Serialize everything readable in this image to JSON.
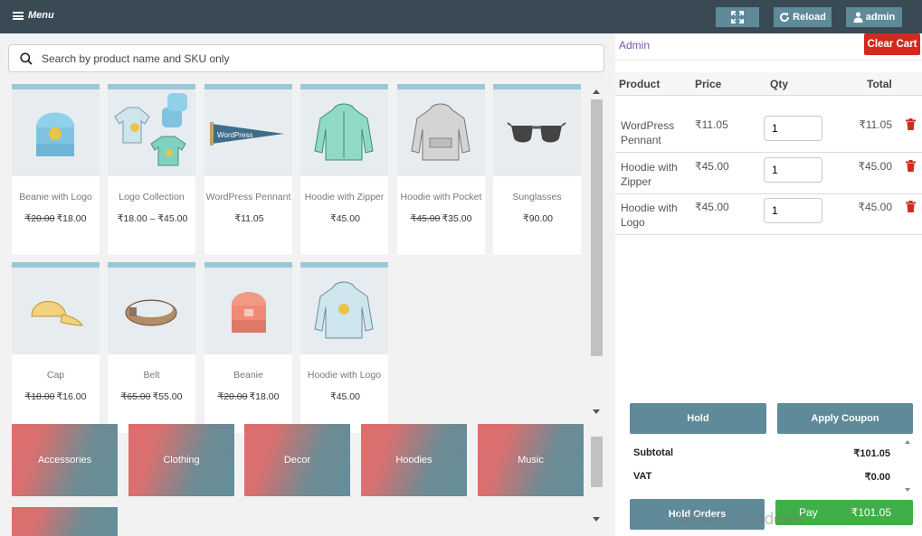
{
  "topbar": {
    "menu_label": "Menu",
    "reload_label": "Reload",
    "admin_label": "admin"
  },
  "search": {
    "placeholder": "Search by product name and SKU only"
  },
  "products": [
    {
      "name": "Beanie with Logo",
      "old_price": "₹20.00",
      "price": "₹18.00"
    },
    {
      "name": "Logo Collection",
      "old_price": "",
      "price": "₹18.00 – ₹45.00"
    },
    {
      "name": "WordPress Pennant",
      "old_price": "",
      "price": "₹11.05"
    },
    {
      "name": "Hoodie with Zipper",
      "old_price": "",
      "price": "₹45.00"
    },
    {
      "name": "Hoodie with Pocket",
      "old_price": "₹45.00",
      "price": "₹35.00"
    },
    {
      "name": "Sunglasses",
      "old_price": "",
      "price": "₹90.00"
    },
    {
      "name": "Cap",
      "old_price": "₹18.00",
      "price": "₹16.00"
    },
    {
      "name": "Belt",
      "old_price": "₹65.00",
      "price": "₹55.00"
    },
    {
      "name": "Beanie",
      "old_price": "₹20.00",
      "price": "₹18.00"
    },
    {
      "name": "Hoodie with Logo",
      "old_price": "",
      "price": "₹45.00"
    }
  ],
  "categories": [
    "Accessories",
    "Clothing",
    "Decor",
    "Hoodies",
    "Music",
    ""
  ],
  "cart": {
    "user": "Admin",
    "clear_label": "Clear Cart",
    "headers": {
      "product": "Product",
      "price": "Price",
      "qty": "Qty",
      "total": "Total"
    },
    "items": [
      {
        "product": "WordPress Pennant",
        "price": "₹11.05",
        "qty": "1",
        "total": "₹11.05"
      },
      {
        "product": "Hoodie with Zipper",
        "price": "₹45.00",
        "qty": "1",
        "total": "₹45.00"
      },
      {
        "product": "Hoodie with Logo",
        "price": "₹45.00",
        "qty": "1",
        "total": "₹45.00"
      }
    ],
    "hold_label": "Hold",
    "coupon_label": "Apply Coupon",
    "subtotal_label": "Subtotal",
    "subtotal": "₹101.05",
    "vat_label": "VAT",
    "vat": "₹0.00",
    "hold_orders_label": "Hold Orders",
    "pay_label": "Pay",
    "pay_amount": "₹101.05"
  },
  "watermark": "Activate Windows",
  "colors": {
    "topbar": "#3a4a54",
    "accent": "#5e8a99",
    "danger": "#d12a1f",
    "success": "#3faf48"
  }
}
